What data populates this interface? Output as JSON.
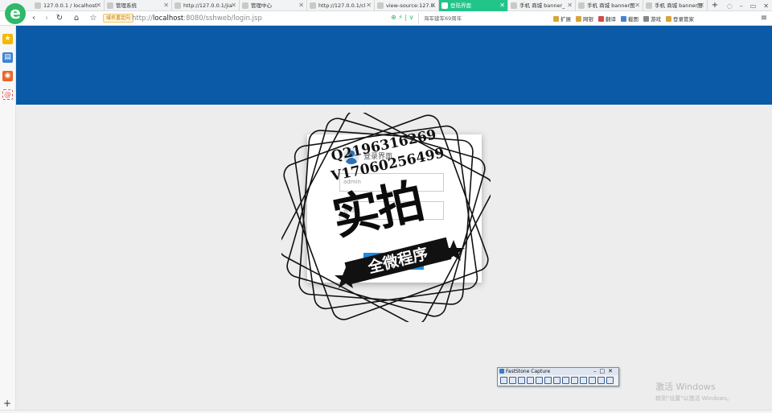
{
  "browser": {
    "logo": "e",
    "tabs": [
      {
        "label": "127.0.0.1 / localhost",
        "active": false
      },
      {
        "label": "管理系统",
        "active": false
      },
      {
        "label": "http://127.0.0.1/jia",
        "active": false
      },
      {
        "label": "管理中心",
        "active": false
      },
      {
        "label": "http://127.0.0.1/cl",
        "active": false
      },
      {
        "label": "view-source:127.0.",
        "active": false
      },
      {
        "label": "登陆界面",
        "active": true
      },
      {
        "label": "手机 商城 banner_",
        "active": false
      },
      {
        "label": "手机 商城 banner图",
        "active": false
      },
      {
        "label": "手机 商城 banner图",
        "active": false
      }
    ],
    "new_tab": "+",
    "window_controls": {
      "skin": "◌",
      "minimize": "–",
      "maximize": "▭",
      "close": "✕"
    },
    "tab_close": "✕"
  },
  "addressbar": {
    "back": "‹",
    "forward": "›",
    "reload": "↻",
    "home": "⌂",
    "bookmark": "☆",
    "safe_badge": "域名重定向",
    "url_prefix": "http://",
    "url_host": "localhost",
    "url_rest": ":8080/sshweb/login.jsp",
    "addr_icons": "⊕ ⚡ | ∨",
    "search_text": "海军建军69周年",
    "search_icon": "🔍",
    "toolbar": {
      "extensions": "扩展",
      "online_banking": "网银",
      "translate": "翻译",
      "screenshot": "截图",
      "games": "游戏",
      "login": "登录管家"
    },
    "menu": "≡"
  },
  "sidebar": {
    "icons": [
      {
        "name": "favorites-icon",
        "glyph": "★",
        "color": "#f5b800"
      },
      {
        "name": "reader-icon",
        "glyph": "▤",
        "color": "#3d84d6"
      },
      {
        "name": "weibo-icon",
        "glyph": "◉",
        "color": "#e8672a"
      },
      {
        "name": "mail-icon",
        "glyph": "@",
        "color": "#e04b4b"
      }
    ],
    "add": "+"
  },
  "login": {
    "title": "登录界面",
    "username_placeholder": "admin",
    "password_placeholder": "密码",
    "submit": "登录"
  },
  "watermark": {
    "qq": "Q2196316269",
    "v": "V17060256499",
    "big": "实拍",
    "ribbon": "全微程序"
  },
  "faststone": {
    "title": "FastStone Capture",
    "controls": "–□✕"
  },
  "activate_windows": {
    "line1": "激活 Windows",
    "line2": "转到\"设置\"以激活 Windows。"
  }
}
